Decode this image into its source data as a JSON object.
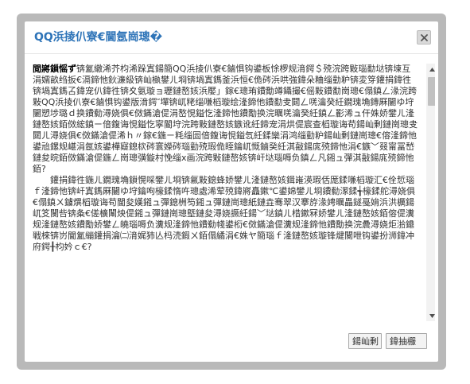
{
  "dialog": {
    "title": "QQ浜掕仈寮€閫氬崗璁�",
    "close_label": "×"
  },
  "agreement": {
    "heading": "閲嶈鎻愮ず",
    "paragraphs": [
      "锛氳繖浠芥枃浠跺寘鍚簡QQ浜掕仈寮€鏀惧钩鍙板悇椤规湇鍔＄殑浣跨敤瑙勫垯锛堜互涓嬬畝绉扳€滆鍗忚鈥濓級锛屾槸鐢ㄦ埛锛堝寘鎷釜浜恒€佹硶浜哄強鍏朵粬缁勭粐锛変笌鑵捐鍏徃锛堝寘鎷叾鍏宠仈鍏徃锛夊氨璇ョ瓑鏈嶅姟浜嬮」鎵€璁珛鐨勪竴鑷撮€傜敤鐨勫崗璁€傝鎮ㄥ湪浣跨敤QQ浜掕仈寮€鏀惧钩鍙版湇鍔″墠锛屼粩缁嗛槄璇绘湰鍗忚鐨勫叏閮ㄥ唴瀹癸紝鐗瑰埆鏄厤闄ゆ垨闄愬埗璐ｄ换鐨勬潯娆俱€傚鏋滄偍涓嶅悓鎰忔湰鍗忚鐨勪换浣曞唴瀹癸紝鎮ㄥ彲浠ュ仠姝娇鐢ㄦ湰鏈嶅姟銆傚綋鎮ㄧ偣鍑诲悓鎰忔寜閽垨浣跨敤鏈嶅姟鏃讹紝鍗宠涓烘偍宸查槄璇诲苟鍚屾剰鏈崗璁叏閮ㄦ潯娆俱€傚鏋滄偍浠ｈ〃鎵€鍦ㄧ粍缁囩偣鍑诲悓鎰忥紝鍒欒涓鸿缁勭粐鍚屾剰鏈崗璁€傛湰鍗忚鍙兘鏍规嵁涓氬姟鍙樺寲鎴栨硶寰嬫硶瑙勭殑瑕佹眰鑰屼慨鏀癸紝淇敼鍚庣殑鍗忚涓€鏃﹀叕甯冨嵆鏈夋晥銆傚鏋滄偍鍦ㄥ崗璁彉鏇村悗缁х画浣跨敤鏈嶅姟锛屽垯瑙嗕负鎮ㄥ凡鎺ュ彈淇敼鍚庣殑鍗忚銆?",
      "鑵捐鍏徃鍦ㄦ鐗瑰埆鎻愰啋鐢ㄦ埛锛氱敤鎴蜂娇鐢ㄦ湰鏈嶅姟鍓嶉渶瑕佸厖鍒嗛槄璇汇€佺悊瑙ｆ湰鍗忚锛屽寘鎷厤闄ゆ垨鑰呴檺鍒惰吘璁處浠荤殑鍏嶈矗鏉℃鍙婂鐢ㄦ埛鐨勬潈鍒╅檺鍒舵潯娆俱€傝鎮ㄨ鐪熼槄璇诲苟閫夋嫨鎺ュ彈鎴栦笉鎺ュ彈鏈崗璁紙鏈垚骞翠汉搴斿湪娉曞畾鐩戞姢浜洪櫔鍚屼笅闃呰锛夈€傞櫎闈炴偍鎺ュ彈鏈崗璁墍鏈夋潯娆撅紝鍚﹀垯鎮ㄦ棤鏉冧娇鐢ㄦ湰鏈嶅姟銆傛偍瀵规湰鏈嶅姟鐨勪娇鐢ㄥ皢瑙嗕负瀵规湰鍗忚鐨勬帴鍙椼€傚鏋滄偍瀵规湰鍗忚鐨勪换浣曟潯娆炬湁鐤戦棶锛岃閫氳繃鑵捐瀹㈡湇娓犻亾杩涜鍜ㄨ銆傝繘涓€姝ヤ簡瑙ｆ湰鏈嶅姟璇锋煡闃呭钩鍙扮浉鍏冲府鍔╂枃妗ｃ€?"
    ]
  },
  "footer": {
    "agree_label": "鍚屾剰",
    "disagree_label": "鍏抽棴"
  },
  "scrollbar": {
    "position": 0.06
  }
}
